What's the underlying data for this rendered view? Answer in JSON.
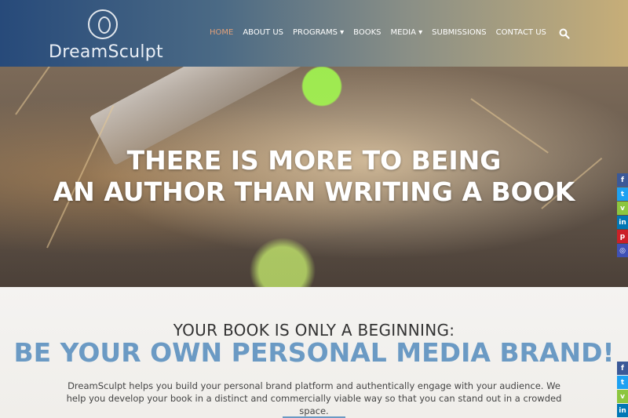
{
  "brand": {
    "name": "DreamSculpt"
  },
  "nav": {
    "items": [
      {
        "label": "HOME",
        "active": true
      },
      {
        "label": "ABOUT US"
      },
      {
        "label": "PROGRAMS ▾"
      },
      {
        "label": "BOOKS"
      },
      {
        "label": "MEDIA ▾"
      },
      {
        "label": "SUBMISSIONS"
      },
      {
        "label": "CONTACT US"
      }
    ],
    "search_icon": "search-icon"
  },
  "hero": {
    "line1": "THERE IS MORE TO BEING",
    "line2": "AN AUTHOR THAN WRITING A BOOK"
  },
  "intro": {
    "kicker": "YOUR BOOK IS ONLY A BEGINNING:",
    "headline": "BE YOUR OWN PERSONAL MEDIA BRAND!",
    "body": "DreamSculpt helps you build your personal brand platform and authentically engage with your audience. We help you develop your book in a distinct and commercially viable way so that you can stand out in a crowded space."
  },
  "social": {
    "top": [
      {
        "icon": "facebook-icon",
        "glyph": "f",
        "color": "#3b5998"
      },
      {
        "icon": "twitter-icon",
        "glyph": "t",
        "color": "#1da1f2"
      },
      {
        "icon": "vine-icon",
        "glyph": "v",
        "color": "#8cc63f"
      },
      {
        "icon": "linkedin-icon",
        "glyph": "in",
        "color": "#0077b5"
      },
      {
        "icon": "pinterest-icon",
        "glyph": "p",
        "color": "#cb2027"
      },
      {
        "icon": "instagram-icon",
        "glyph": "◎",
        "color": "#3f51b5"
      }
    ],
    "bottom": [
      {
        "icon": "facebook-icon",
        "glyph": "f",
        "color": "#3b5998"
      },
      {
        "icon": "twitter-icon",
        "glyph": "t",
        "color": "#1da1f2"
      },
      {
        "icon": "vine-icon",
        "glyph": "v",
        "color": "#8cc63f"
      },
      {
        "icon": "linkedin-icon",
        "glyph": "in",
        "color": "#0077b5"
      }
    ]
  },
  "colors": {
    "accent": "#6b9ac4",
    "nav_active": "#e0a07a"
  }
}
